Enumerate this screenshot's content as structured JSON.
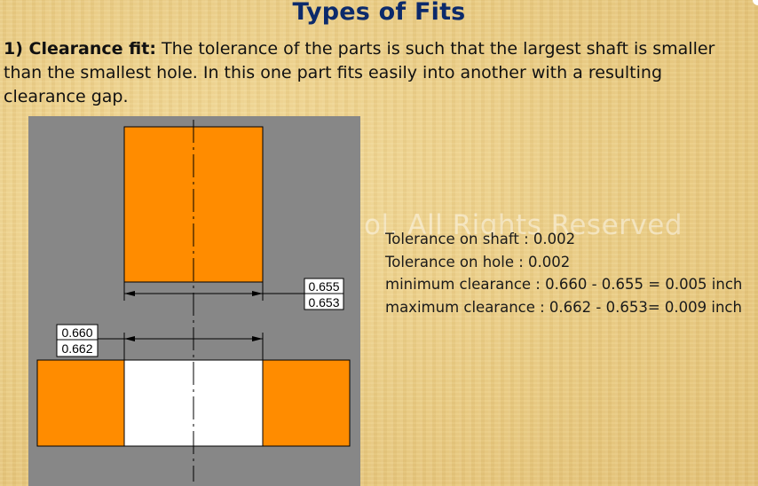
{
  "title": "Types of Fits",
  "paragraph": {
    "lead": "1) Clearance fit:",
    "body": " The tolerance of the parts is such that the largest shaft is  smaller than the smallest hole. In this one part fits easily into another with a resulting clearance gap."
  },
  "watermark": "ol. All Rights Reserved",
  "info_lines": [
    "Tolerance on shaft : 0.002",
    "Tolerance on hole : 0.002",
    "minimum clearance : 0.660 - 0.655 = 0.005 inch",
    "maximum clearance : 0.662 - 0.653= 0.009 inch"
  ],
  "diagram": {
    "shaft_dim": {
      "upper": "0.655",
      "lower": "0.653"
    },
    "hole_dim": {
      "upper": "0.660",
      "lower": "0.662"
    },
    "colors": {
      "background": "#878787",
      "part": "#ff8c00",
      "hole": "#ffffff",
      "line": "#000000"
    }
  }
}
